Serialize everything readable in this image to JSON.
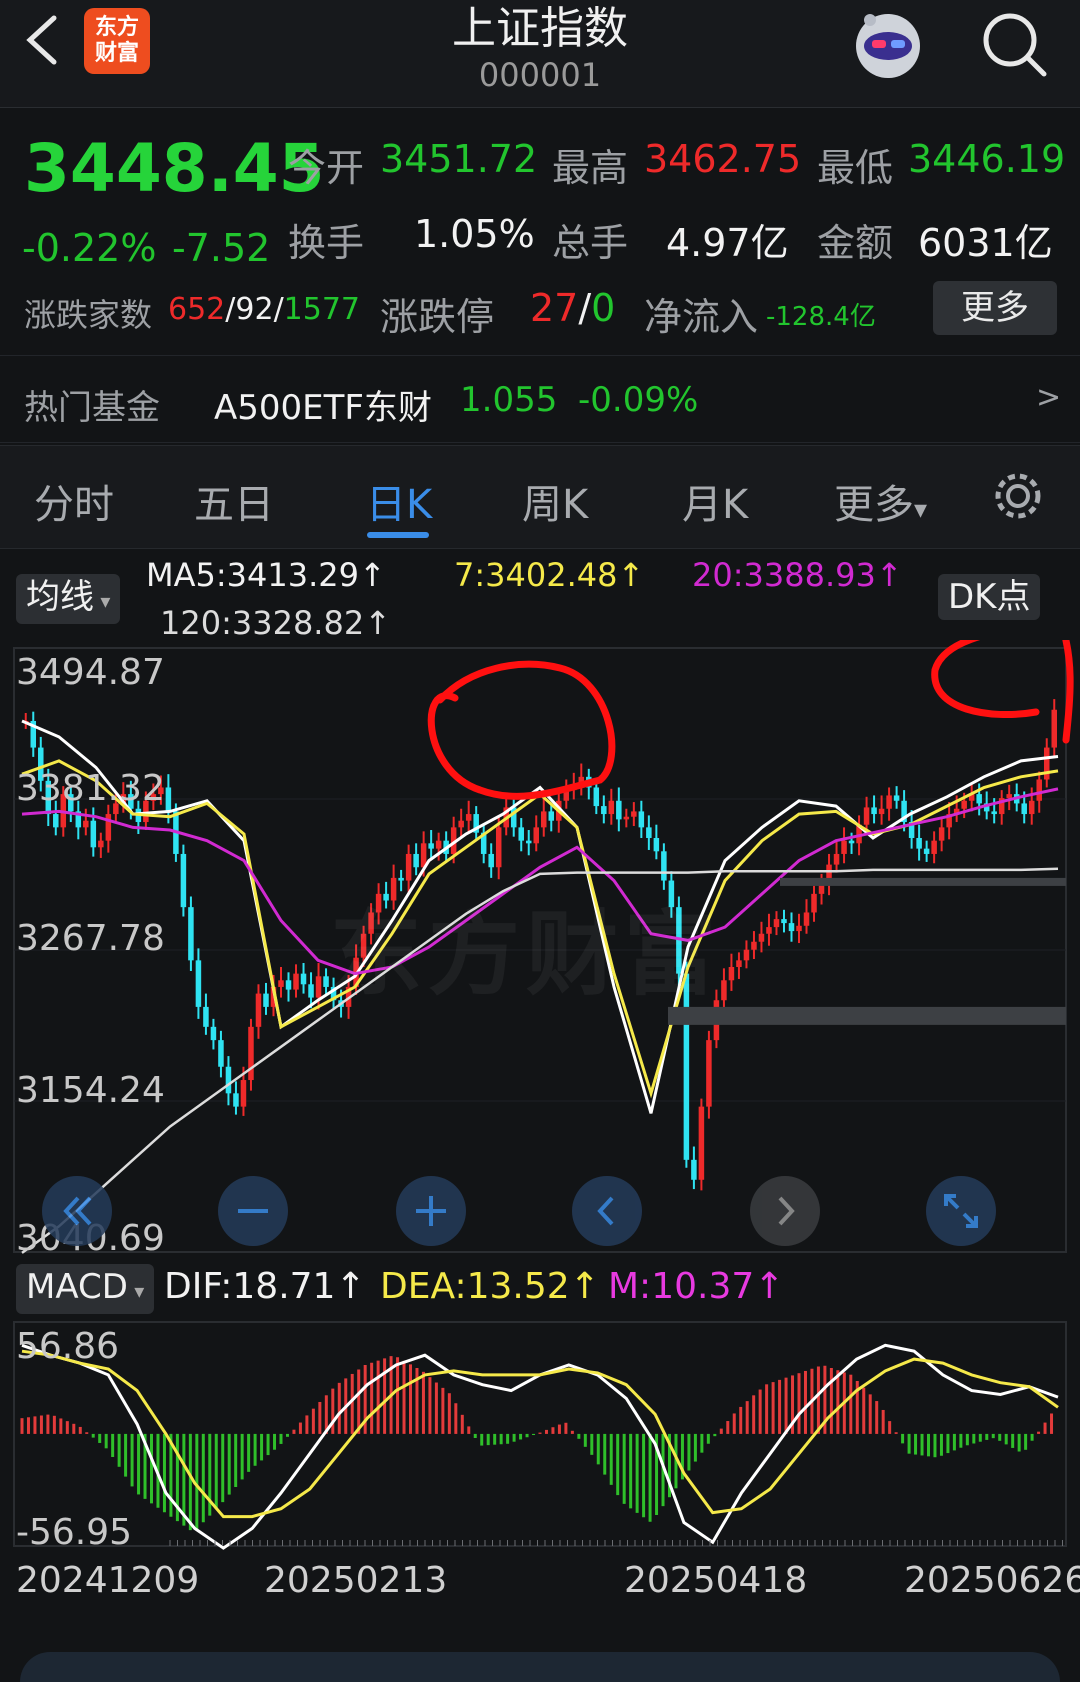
{
  "header": {
    "title": "上证指数",
    "code": "000001",
    "logo_line1": "东方",
    "logo_line2": "财富"
  },
  "quote": {
    "price": "3448.45",
    "change_pct": "-0.22%",
    "change": "-7.52",
    "open_label": "今开",
    "open": "3451.72",
    "high_label": "最高",
    "high": "3462.75",
    "low_label": "最低",
    "low": "3446.19",
    "turnover_label": "换手",
    "turnover": "1.05%",
    "volume_label": "总手",
    "volume": "4.97亿",
    "amount_label": "金额",
    "amount": "6031亿",
    "breadth_label": "涨跌家数",
    "up": "652",
    "sep1": "/",
    "flat": "92",
    "sep2": "/",
    "down": "1577",
    "limit_label": "涨跌停",
    "limit_up": "27",
    "limit_sep": "/",
    "limit_down": "0",
    "netflow_label": "净流入",
    "netflow": "-128.4亿",
    "more_button": "更多"
  },
  "fund": {
    "label": "热门基金",
    "name": "A500ETF东财",
    "price": "1.055",
    "change": "-0.09%",
    "arrow": ">"
  },
  "tabs": [
    {
      "label": "分时"
    },
    {
      "label": "五日"
    },
    {
      "label": "日K"
    },
    {
      "label": "周K"
    },
    {
      "label": "月K"
    },
    {
      "label": "更多"
    }
  ],
  "tab_more_caret": "▾",
  "ma_panel": {
    "selector": "均线",
    "ma5": "MA5:3413.29↑",
    "ma7": "7:3402.48↑",
    "ma20": "20:3388.93↑",
    "ma120": "120:3328.82↑",
    "dk_button": "DK点"
  },
  "price_axis": [
    "3494.87",
    "3381.32",
    "3267.78",
    "3154.24",
    "3040.69"
  ],
  "watermark": "东方财富",
  "macd_panel": {
    "selector": "MACD",
    "dif": "DIF:18.71↑",
    "dea": "DEA:13.52↑",
    "m": "M:10.37↑",
    "axis_top": "56.86",
    "axis_bottom": "-56.95"
  },
  "dates": [
    "20241209",
    "20250213",
    "20250418",
    "20250626"
  ],
  "colors": {
    "up": "#ee2a2a",
    "down": "#2fe3f2",
    "ma5": "#ffffff",
    "ma7": "#f5e94a",
    "ma20": "#d12ad1",
    "ma120": "#dcdcdc",
    "accent": "#3a8de8"
  },
  "chart_data": [
    {
      "type": "candlestick",
      "title": "",
      "ylim": [
        3040.69,
        3494.87
      ],
      "y_ticks": [
        3494.87,
        3381.32,
        3267.78,
        3154.24,
        3040.69
      ],
      "x_ticks": [
        "20241209",
        "20250213",
        "20250418",
        "20250626"
      ],
      "closes": [
        3440,
        3420,
        3395,
        3370,
        3360,
        3385,
        3372,
        3360,
        3365,
        3345,
        3350,
        3370,
        3378,
        3385,
        3374,
        3364,
        3380,
        3385,
        3390,
        3372,
        3340,
        3300,
        3260,
        3225,
        3210,
        3200,
        3180,
        3160,
        3150,
        3170,
        3210,
        3235,
        3225,
        3240,
        3245,
        3238,
        3250,
        3242,
        3232,
        3248,
        3240,
        3230,
        3225,
        3240,
        3262,
        3280,
        3296,
        3310,
        3305,
        3322,
        3320,
        3340,
        3330,
        3348,
        3344,
        3350,
        3340,
        3360,
        3365,
        3370,
        3356,
        3340,
        3330,
        3360,
        3375,
        3360,
        3350,
        3348,
        3360,
        3372,
        3365,
        3380,
        3388,
        3392,
        3398,
        3390,
        3376,
        3370,
        3380,
        3366,
        3368,
        3372,
        3360,
        3352,
        3342,
        3320,
        3300,
        3250,
        3110,
        3095,
        3150,
        3200,
        3230,
        3245,
        3255,
        3260,
        3268,
        3274,
        3280,
        3285,
        3291,
        3288,
        3282,
        3286,
        3296,
        3310,
        3318,
        3332,
        3340,
        3350,
        3348,
        3362,
        3375,
        3370,
        3374,
        3384,
        3380,
        3364,
        3352,
        3344,
        3340,
        3350,
        3360,
        3370,
        3374,
        3380,
        3385,
        3378,
        3372,
        3370,
        3382,
        3385,
        3378,
        3370,
        3380,
        3396,
        3420,
        3448.45
      ],
      "series": [
        {
          "name": "MA5",
          "values": [
            3440,
            3428,
            3405,
            3370,
            3372,
            3380,
            3350,
            3210,
            3230,
            3248,
            3290,
            3335,
            3355,
            3370,
            3390,
            3360,
            3240,
            3145,
            3270,
            3335,
            3360,
            3380,
            3376,
            3352,
            3370,
            3383,
            3398,
            3410,
            3413.29
          ]
        },
        {
          "name": "7",
          "values": [
            3400,
            3410,
            3395,
            3370,
            3368,
            3378,
            3355,
            3210,
            3225,
            3240,
            3280,
            3325,
            3345,
            3365,
            3385,
            3360,
            3250,
            3160,
            3255,
            3320,
            3350,
            3370,
            3372,
            3355,
            3362,
            3376,
            3390,
            3398,
            3402.48
          ]
        },
        {
          "name": "20",
          "values": [
            3370,
            3372,
            3368,
            3360,
            3358,
            3350,
            3335,
            3290,
            3260,
            3250,
            3255,
            3270,
            3290,
            3310,
            3330,
            3345,
            3320,
            3280,
            3275,
            3285,
            3310,
            3335,
            3350,
            3356,
            3362,
            3368,
            3376,
            3383,
            3388.93
          ]
        },
        {
          "name": "120",
          "values": [
            3040,
            3060,
            3085,
            3110,
            3135,
            3155,
            3175,
            3195,
            3215,
            3235,
            3255,
            3275,
            3295,
            3312,
            3325,
            3326,
            3326,
            3326,
            3326,
            3327,
            3327,
            3327,
            3327,
            3328,
            3328,
            3328,
            3328,
            3328,
            3328.82
          ]
        }
      ]
    },
    {
      "type": "bar",
      "title": "MACD",
      "ylim": [
        -56.95,
        56.86
      ],
      "series": [
        {
          "name": "DIF",
          "values": [
            45,
            40,
            36,
            30,
            5,
            -30,
            -48,
            -58,
            -48,
            -30,
            -10,
            10,
            25,
            35,
            40,
            30,
            25,
            22,
            30,
            35,
            30,
            18,
            -5,
            -45,
            -55,
            -30,
            -10,
            10,
            25,
            38,
            45,
            42,
            30,
            22,
            20,
            24,
            18.71
          ]
        },
        {
          "name": "DEA",
          "values": [
            42,
            40,
            36,
            33,
            22,
            0,
            -25,
            -42,
            -42,
            -38,
            -28,
            -10,
            8,
            22,
            30,
            32,
            30,
            30,
            30,
            33,
            31,
            25,
            10,
            -20,
            -40,
            -38,
            -28,
            -10,
            8,
            22,
            32,
            38,
            36,
            30,
            26,
            24,
            13.52
          ]
        },
        {
          "name": "M",
          "values": [
            8,
            10,
            4,
            -8,
            -30,
            -40,
            -50,
            -35,
            -18,
            -6,
            10,
            25,
            35,
            40,
            32,
            20,
            -6,
            -5,
            0,
            6,
            -12,
            -35,
            -45,
            -25,
            -5,
            12,
            25,
            30,
            35,
            30,
            15,
            -10,
            -12,
            -6,
            -2,
            -10,
            10.37
          ]
        }
      ]
    }
  ]
}
